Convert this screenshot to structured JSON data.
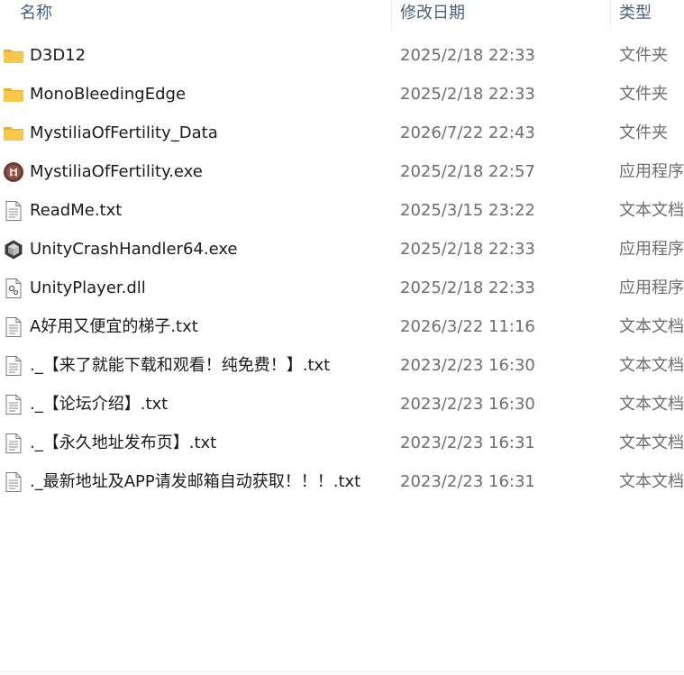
{
  "columns": {
    "name": "名称",
    "date": "修改日期",
    "type": "类型"
  },
  "files": [
    {
      "icon": "folder-icon",
      "name": "D3D12",
      "date": "2025/2/18 22:33",
      "type": "文件夹"
    },
    {
      "icon": "folder-icon",
      "name": "MonoBleedingEdge",
      "date": "2025/2/18 22:33",
      "type": "文件夹"
    },
    {
      "icon": "folder-icon",
      "name": "MystiliaOfFertility_Data",
      "date": "2026/7/22 22:43",
      "type": "文件夹"
    },
    {
      "icon": "game-app-icon",
      "name": "MystiliaOfFertility.exe",
      "date": "2025/2/18 22:57",
      "type": "应用程序"
    },
    {
      "icon": "text-file-icon",
      "name": "ReadMe.txt",
      "date": "2025/3/15 23:22",
      "type": "文本文档"
    },
    {
      "icon": "unity-icon",
      "name": "UnityCrashHandler64.exe",
      "date": "2025/2/18 22:33",
      "type": "应用程序"
    },
    {
      "icon": "dll-file-icon",
      "name": "UnityPlayer.dll",
      "date": "2025/2/18 22:33",
      "type": "应用程序"
    },
    {
      "icon": "text-file-icon",
      "name": "A好用又便宜的梯子.txt",
      "date": "2026/3/22 11:16",
      "type": "文本文档"
    },
    {
      "icon": "text-file-icon",
      "name": "._【来了就能下载和观看！纯免费！】.txt",
      "date": "2023/2/23 16:30",
      "type": "文本文档"
    },
    {
      "icon": "text-file-icon",
      "name": "._【论坛介绍】.txt",
      "date": "2023/2/23 16:30",
      "type": "文本文档"
    },
    {
      "icon": "text-file-icon",
      "name": "._【永久地址发布页】.txt",
      "date": "2023/2/23 16:31",
      "type": "文本文档"
    },
    {
      "icon": "text-file-icon",
      "name": "._最新地址及APP请发邮箱自动获取！！！.txt",
      "date": "2023/2/23 16:31",
      "type": "文本文档"
    }
  ],
  "colors": {
    "header_text": "#4c607a",
    "folder": "#f8c84c",
    "date_text": "#6d6d6d"
  }
}
